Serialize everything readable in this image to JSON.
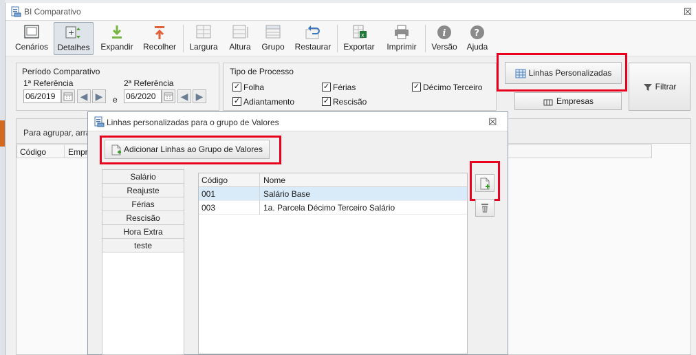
{
  "window": {
    "title": "BI Comparativo",
    "close": "☒"
  },
  "toolbar": {
    "items": [
      {
        "label": "Cenários",
        "icon": "scenarios-icon"
      },
      {
        "label": "Detalhes",
        "icon": "details-icon",
        "active": true
      },
      {
        "label": "Expandir",
        "icon": "expand-icon"
      },
      {
        "label": "Recolher",
        "icon": "collapse-icon"
      },
      {
        "label": "Largura",
        "icon": "width-icon"
      },
      {
        "label": "Altura",
        "icon": "height-icon"
      },
      {
        "label": "Grupo",
        "icon": "group-icon"
      },
      {
        "label": "Restaurar",
        "icon": "restore-icon"
      },
      {
        "label": "Exportar",
        "icon": "excel-export-icon"
      },
      {
        "label": "Imprimir",
        "icon": "printer-icon"
      },
      {
        "label": "Versão",
        "icon": "info-icon"
      },
      {
        "label": "Ajuda",
        "icon": "help-icon"
      }
    ]
  },
  "periodo": {
    "title": "Período Comparativo",
    "ref1_label": "1ª Referência",
    "ref1_value": "06/2019",
    "ref2_label": "2ª Referência",
    "ref2_value": "06/2020",
    "conjunction": "e"
  },
  "tipo": {
    "title": "Tipo de Processo",
    "options": [
      {
        "label": "Folha",
        "checked": true
      },
      {
        "label": "Férias",
        "checked": true
      },
      {
        "label": "Décimo Terceiro",
        "checked": true
      },
      {
        "label": "Adiantamento",
        "checked": true
      },
      {
        "label": "Rescisão",
        "checked": true
      }
    ]
  },
  "actions": {
    "linhas_personalizadas": "Linhas Personalizadas",
    "empresas": "Empresas",
    "filtrar": "Filtrar"
  },
  "main_grid": {
    "group_hint": "Para agrupar, arra",
    "col_codigo": "Código",
    "col_empresa": "Empr"
  },
  "dialog": {
    "title": "Linhas personalizadas para o grupo de Valores",
    "close": "☒",
    "add_button": "Adicionar Linhas ao Grupo de Valores",
    "groups": [
      "Salário",
      "Reajuste",
      "Férias",
      "Rescisão",
      "Hora Extra",
      "teste"
    ],
    "grid": {
      "headers": {
        "codigo": "Código",
        "nome": "Nome"
      },
      "rows": [
        {
          "codigo": "001",
          "nome": "Salário Base",
          "selected": true
        },
        {
          "codigo": "003",
          "nome": "1a. Parcela Décimo Terceiro Salário",
          "selected": false
        }
      ]
    }
  },
  "colors": {
    "highlight": "#e8001c",
    "selected_row": "#d9eaf8",
    "accent_orange": "#d2691e"
  }
}
